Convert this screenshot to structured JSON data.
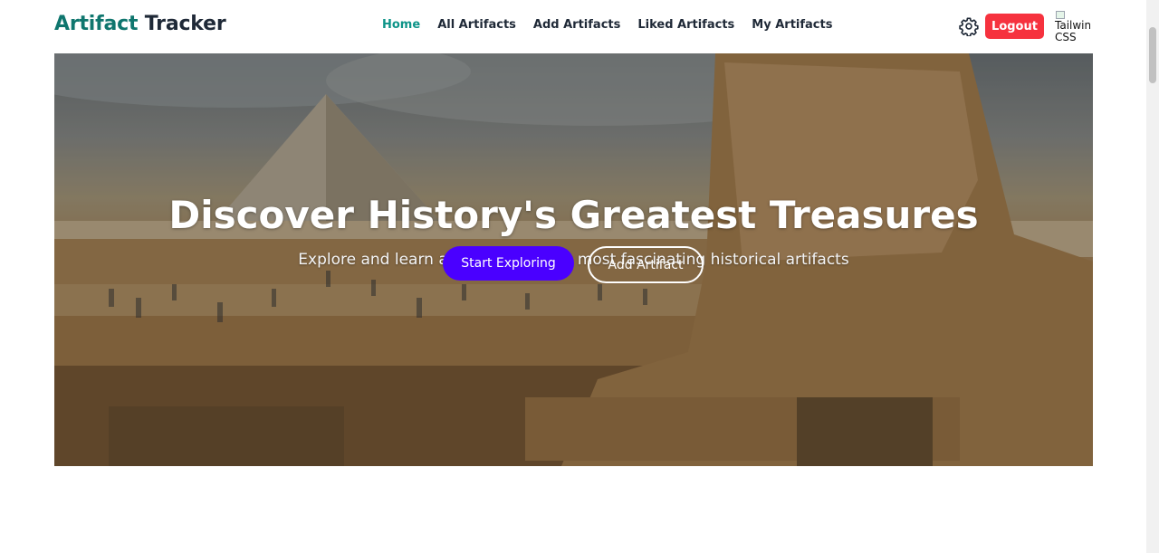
{
  "brand": {
    "part1": "Artifact",
    "part2": "Tracker"
  },
  "nav": [
    {
      "label": "Home",
      "active": true
    },
    {
      "label": "All Artifacts",
      "active": false
    },
    {
      "label": "Add Artifacts",
      "active": false
    },
    {
      "label": "Liked Artifacts",
      "active": false
    },
    {
      "label": "My Artifacts",
      "active": false
    }
  ],
  "header": {
    "theme_icon": "gear-icon",
    "logout_label": "Logout",
    "avatar_alt": "Tailwind CSS"
  },
  "hero": {
    "title": "Discover History's Greatest Treasures",
    "subtitle": "Explore and learn about the world's most fascinating historical artifacts",
    "primary_button": "Start Exploring",
    "secondary_button": "Add Artifact",
    "background_image": "Pyramid and Great Sphinx of Giza with tourists"
  },
  "colors": {
    "brand_accent": "#0f766e",
    "nav_active": "#0d9488",
    "logout_bg": "#f6323e",
    "primary_button_bg": "#4a00ff"
  }
}
